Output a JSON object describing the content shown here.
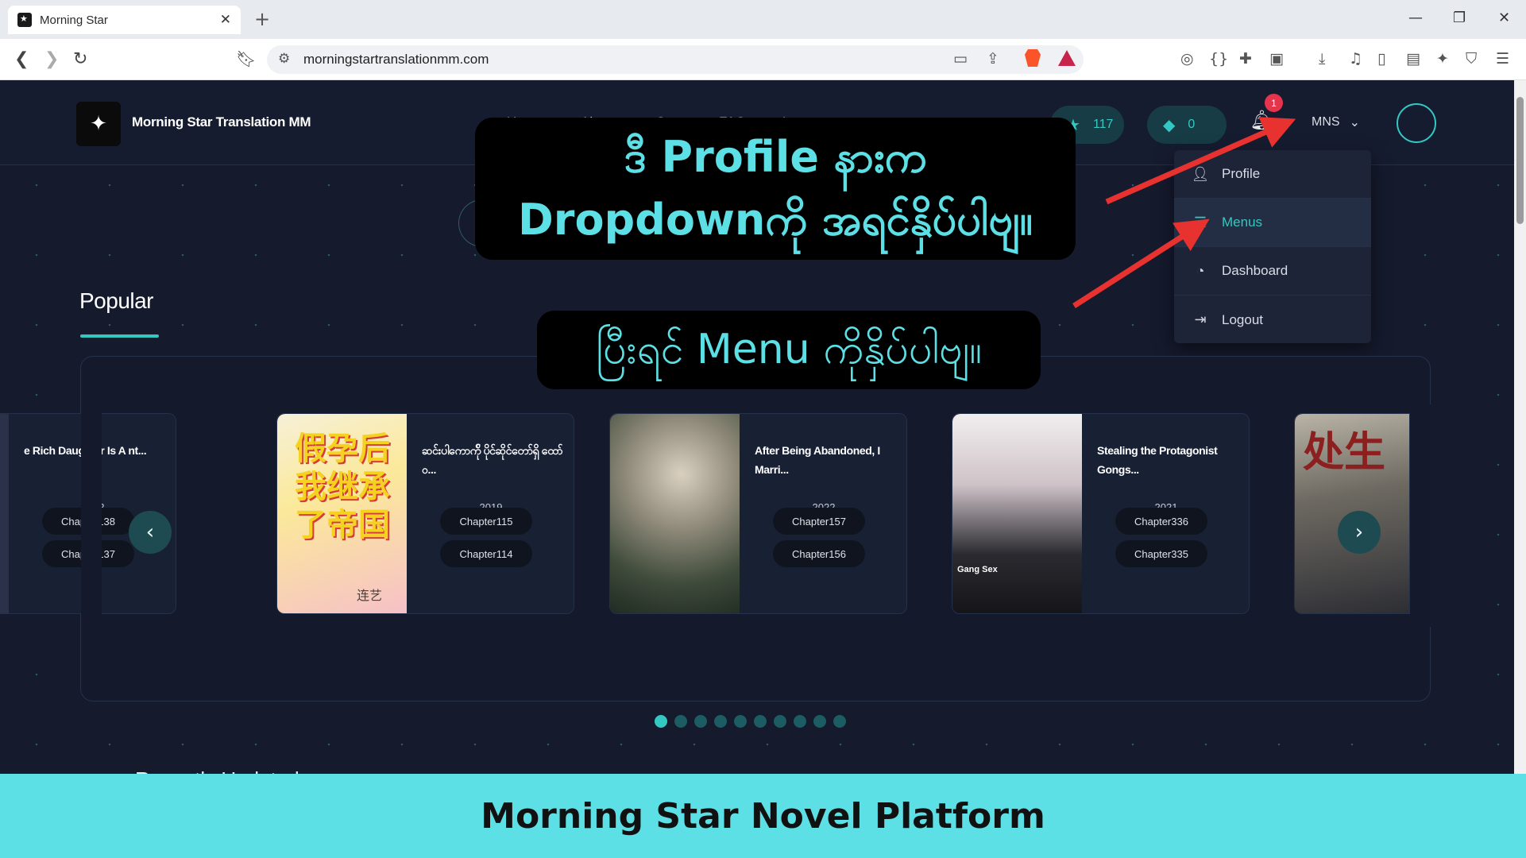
{
  "browser": {
    "tab_title": "Morning Star",
    "url": "morningstartranslationmm.com"
  },
  "site": {
    "brand": "Morning Star Translation MM",
    "nav_links": [
      "Home",
      "About",
      "St",
      "FAQ",
      "L"
    ],
    "stars_count": "117",
    "gems_count": "0",
    "notification_count": "1",
    "username": "MNS"
  },
  "dropdown": {
    "items": [
      {
        "label": "Profile",
        "icon": "user-icon"
      },
      {
        "label": "Menus",
        "icon": "list-icon"
      },
      {
        "label": "Dashboard",
        "icon": "gauge-icon"
      },
      {
        "label": "Logout",
        "icon": "logout-icon"
      }
    ]
  },
  "popular": {
    "title": "Popular",
    "cards": [
      {
        "title": "e Rich Daughter Is A nt...",
        "year": "2022",
        "chapters": [
          "Chapter138",
          "Chapter137"
        ]
      },
      {
        "title": "ဆင်းပါကောက်ို ပိုင်ဆိုင်တော်ရှိ ထော်ဝ...",
        "year": "2019",
        "chapters": [
          "Chapter115",
          "Chapter114"
        ]
      },
      {
        "title": "After Being Abandoned, I Marri...",
        "year": "2022",
        "chapters": [
          "Chapter157",
          "Chapter156"
        ]
      },
      {
        "title": "Stealing the Protagonist Gongs...",
        "year": "2021",
        "chapters": [
          "Chapter336",
          "Chapter335"
        ]
      }
    ],
    "cover_text": {
      "card2": "假孕后我继承了帝国",
      "card2_sig": "连艺",
      "card4": "Gang Sex",
      "card5": "处生"
    },
    "dots_total": 10,
    "dots_active": 0
  },
  "below_section": "Recently Updated",
  "annotations": {
    "callout_1_line1": "ဒီ Profile နားက",
    "callout_1_line2": "Dropdownကို အရင်နှိပ်ပါဗျ။",
    "callout_2": "ပြီးရင် Menu ကိုနှိပ်ပါဗျ။",
    "arrow_color": "#e8322f"
  },
  "footer_banner": "Morning Star Novel Platform",
  "colors": {
    "accent": "#33c8c2",
    "page_bg": "#151a2d",
    "banner_bg": "#5ddfe6",
    "badge": "#e5344b"
  }
}
